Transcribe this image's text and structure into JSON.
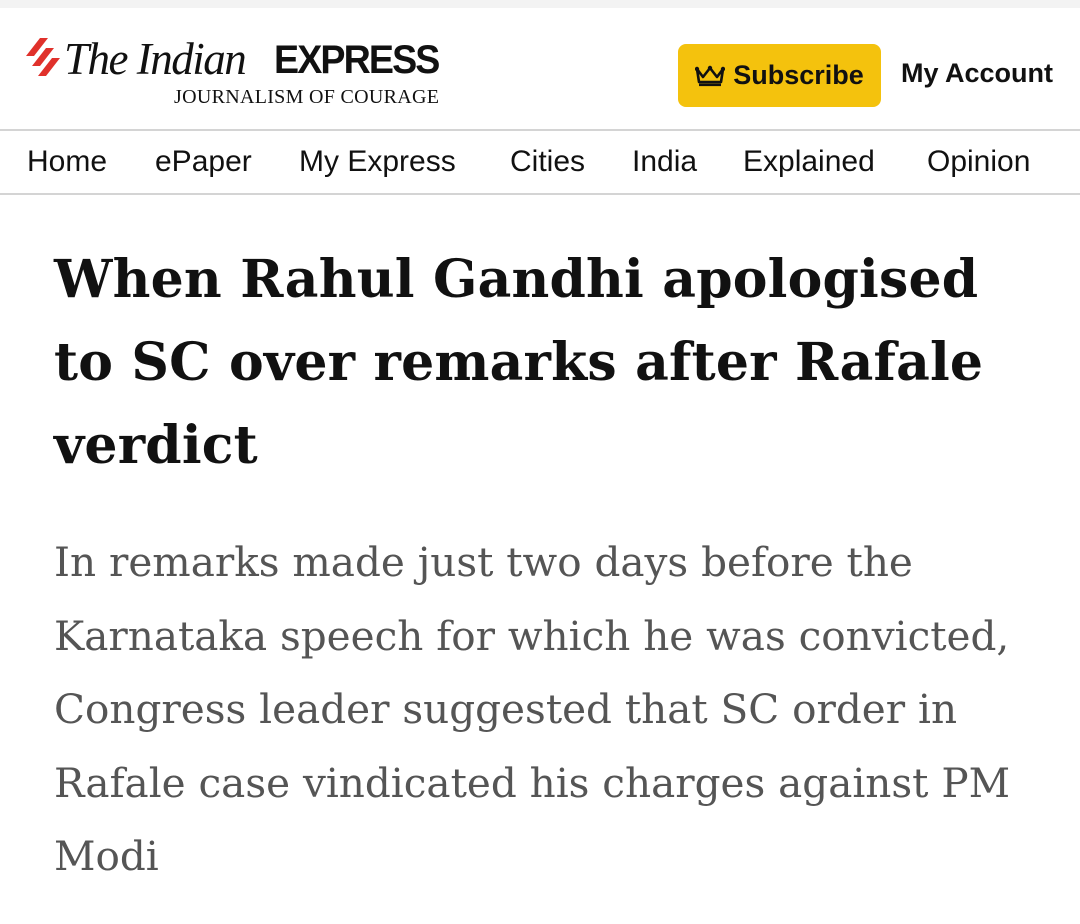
{
  "header": {
    "logo": {
      "the_indian": "The Indian",
      "express": "EXPRESS",
      "tagline": "JOURNALISM OF COURAGE"
    },
    "subscribe_icon": "crown-icon",
    "subscribe_label": "Subscribe",
    "my_account_label": "My Account"
  },
  "nav": {
    "items": [
      "Home",
      "ePaper",
      "My Express",
      "Cities",
      "India",
      "Explained",
      "Opinion"
    ]
  },
  "article": {
    "headline": "When Rahul Gandhi apologised to SC over remarks after Rafale verdict",
    "synopsis": "In remarks made just two days before the Karnataka speech for which he was convicted, Congress leader suggested that SC order in Rafale case vindicated his charges against PM Modi"
  },
  "colors": {
    "brand_red": "#e0312b",
    "subscribe_yellow": "#f4c20d",
    "headline_text": "#111111",
    "synopsis_text": "#555555",
    "divider": "#d4d4d4"
  }
}
